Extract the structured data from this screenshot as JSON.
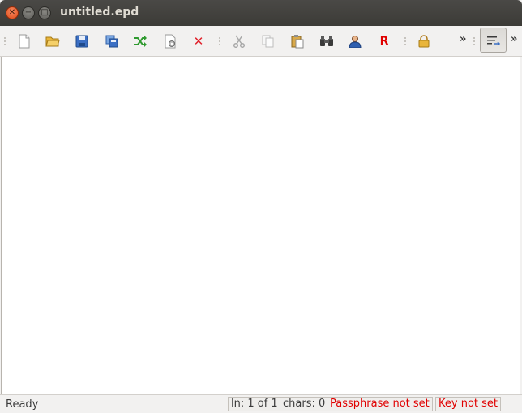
{
  "window": {
    "title": "untitled.epd",
    "controls": [
      "close-icon",
      "minimize-icon",
      "maximize-icon"
    ]
  },
  "toolbar": {
    "buttons": [
      {
        "name": "new-file-button",
        "icon": "new-document-icon"
      },
      {
        "name": "open-file-button",
        "icon": "folder-open-icon"
      },
      {
        "name": "save-button",
        "icon": "floppy-disk-icon"
      },
      {
        "name": "save-as-button",
        "icon": "save-as-icon"
      },
      {
        "name": "reload-button",
        "icon": "shuffle-arrows-icon"
      },
      {
        "name": "properties-button",
        "icon": "document-gear-icon"
      },
      {
        "name": "close-file-button",
        "icon": "red-x-icon"
      },
      {
        "name": "cut-button",
        "icon": "scissors-icon"
      },
      {
        "name": "copy-button",
        "icon": "copy-icon"
      },
      {
        "name": "paste-button",
        "icon": "paste-icon"
      },
      {
        "name": "binoculars-button",
        "icon": "binoculars-icon"
      },
      {
        "name": "user-button",
        "icon": "user-icon"
      },
      {
        "name": "r-button",
        "icon": "red-r-icon"
      },
      {
        "name": "lock-button",
        "icon": "padlock-icon"
      }
    ],
    "overflow_label": "»",
    "overflow_label_2": "»",
    "r_label": "R",
    "close_label": "✕"
  },
  "editor": {
    "content": ""
  },
  "statusbar": {
    "ready": "Ready",
    "line": "ln: 1 of 1",
    "chars": "chars: 0",
    "passphrase": "Passphrase not set",
    "key": "Key not set",
    "warning_color": "#e00000"
  }
}
